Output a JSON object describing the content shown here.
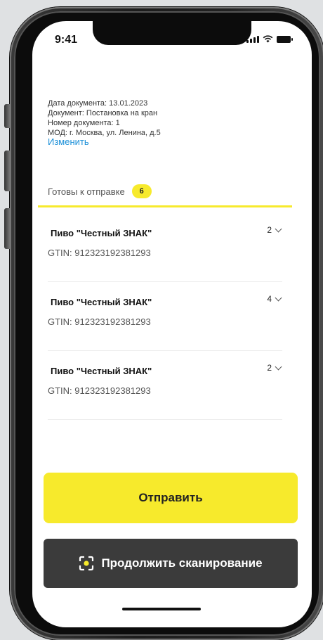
{
  "status_bar": {
    "time": "9:41"
  },
  "document": {
    "date_line": "Дата документа: 13.01.2023",
    "doc_line": "Документ: Постановка на кран",
    "number_line": "Номер документа: 1",
    "mod_line": "МОД: г. Москва, ул. Ленина, д.5",
    "change_link": "Изменить"
  },
  "tab": {
    "label": "Готовы к отправке",
    "count": "6"
  },
  "items": [
    {
      "name": "Пиво \"Честный ЗНАК\"",
      "gtin": "GTIN: 912323192381293",
      "qty": "2"
    },
    {
      "name": "Пиво \"Честный ЗНАК\"",
      "gtin": "GTIN: 912323192381293",
      "qty": "4"
    },
    {
      "name": "Пиво \"Честный ЗНАК\"",
      "gtin": "GTIN: 912323192381293",
      "qty": "2"
    }
  ],
  "actions": {
    "send_label": "Отправить",
    "continue_scan_label": "Продолжить сканирование"
  },
  "icons": {
    "scan": "scan-frame-icon",
    "chevron": "chevron-down-icon",
    "signal": "cellular-signal-icon",
    "wifi": "wifi-icon",
    "battery": "battery-icon"
  },
  "colors": {
    "accent_yellow": "#f7ea2c",
    "dark_button": "#3b3b3b",
    "link_blue": "#1a8fd8"
  }
}
